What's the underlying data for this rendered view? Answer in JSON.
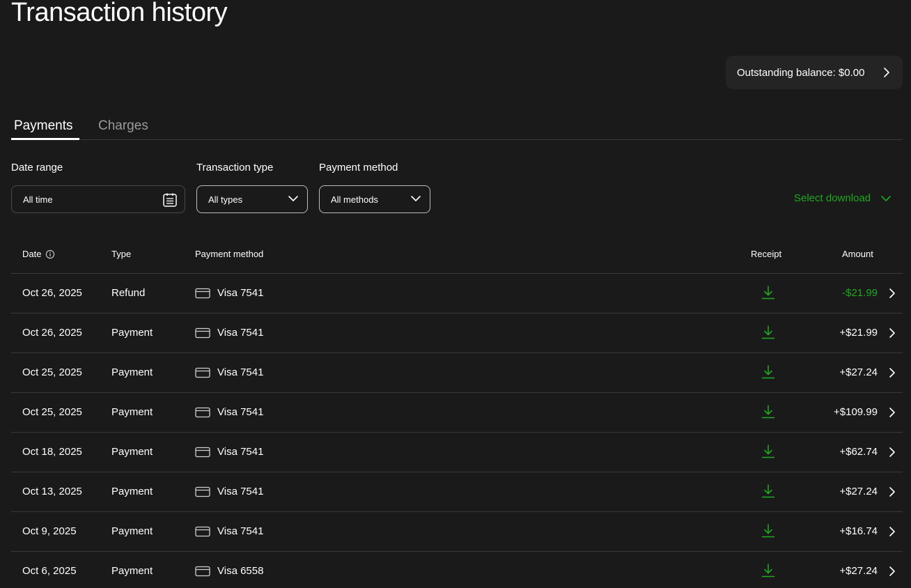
{
  "page": {
    "title": "Transaction history"
  },
  "balance": {
    "label": "Outstanding balance: $0.00"
  },
  "tabs": [
    {
      "label": "Payments",
      "active": true
    },
    {
      "label": "Charges",
      "active": false
    }
  ],
  "filters": {
    "date_range": {
      "label": "Date range",
      "value": "All time"
    },
    "transaction_type": {
      "label": "Transaction type",
      "value": "All types"
    },
    "payment_method": {
      "label": "Payment method",
      "value": "All methods"
    }
  },
  "download": {
    "label": "Select download"
  },
  "table": {
    "columns": {
      "date": "Date",
      "type": "Type",
      "method": "Payment method",
      "receipt": "Receipt",
      "amount": "Amount"
    },
    "rows": [
      {
        "date": "Oct 26, 2025",
        "type": "Refund",
        "method": "Visa 7541",
        "amount": "-$21.99",
        "negative": true
      },
      {
        "date": "Oct 26, 2025",
        "type": "Payment",
        "method": "Visa 7541",
        "amount": "+$21.99",
        "negative": false
      },
      {
        "date": "Oct 25, 2025",
        "type": "Payment",
        "method": "Visa 7541",
        "amount": "+$27.24",
        "negative": false
      },
      {
        "date": "Oct 25, 2025",
        "type": "Payment",
        "method": "Visa 7541",
        "amount": "+$109.99",
        "negative": false
      },
      {
        "date": "Oct 18, 2025",
        "type": "Payment",
        "method": "Visa 7541",
        "amount": "+$62.74",
        "negative": false
      },
      {
        "date": "Oct 13, 2025",
        "type": "Payment",
        "method": "Visa 7541",
        "amount": "+$27.24",
        "negative": false
      },
      {
        "date": "Oct 9, 2025",
        "type": "Payment",
        "method": "Visa 7541",
        "amount": "+$16.74",
        "negative": false
      },
      {
        "date": "Oct 6, 2025",
        "type": "Payment",
        "method": "Visa 6558",
        "amount": "+$27.24",
        "negative": false
      }
    ]
  },
  "colors": {
    "background": "#1a1a1a",
    "accent_green": "#22a722",
    "text": "#ffffff",
    "muted": "#9a9a9a"
  },
  "icons": [
    "info-icon",
    "calendar-icon",
    "chevron-down-icon",
    "chevron-right-icon",
    "credit-card-icon",
    "download-icon"
  ]
}
